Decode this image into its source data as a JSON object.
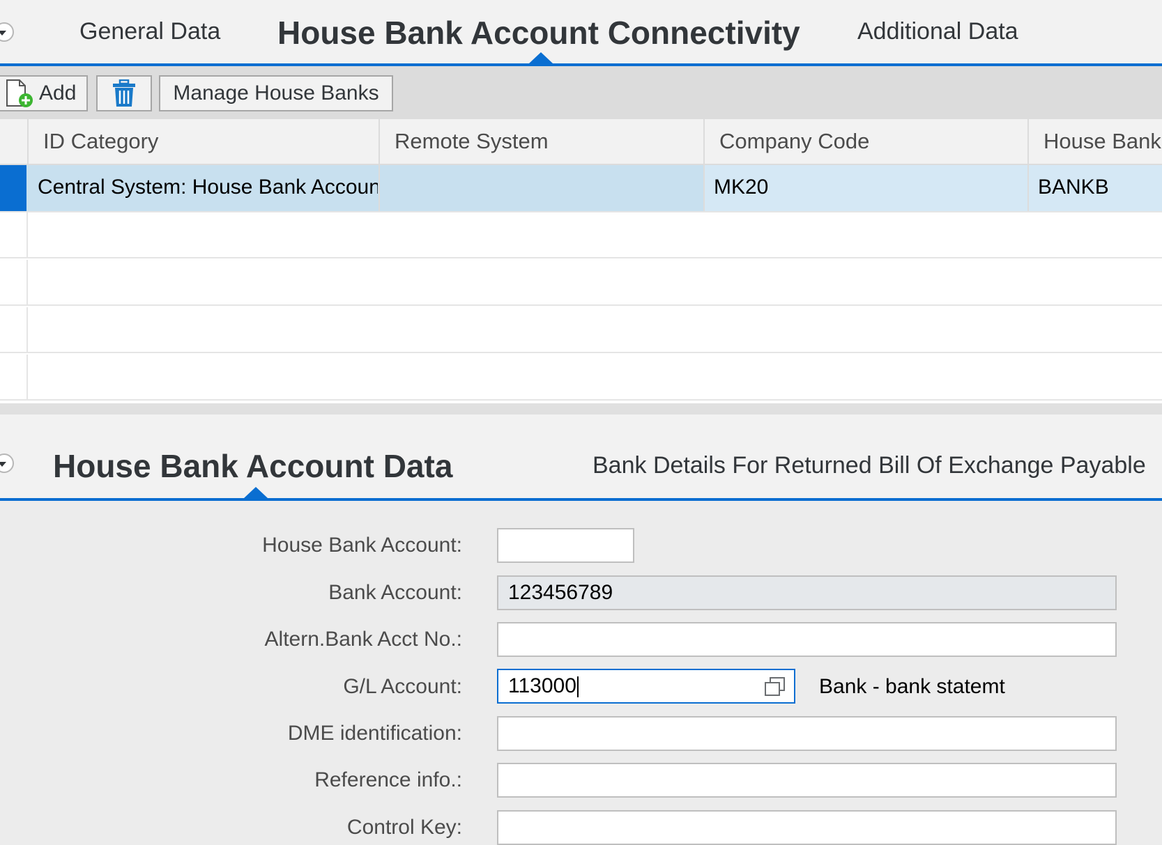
{
  "top_tabs": {
    "general": "General Data",
    "active": "House Bank Account Connectivity",
    "additional": "Additional Data"
  },
  "toolbar": {
    "add_label": "Add",
    "delete_icon": "trash-icon",
    "manage_label": "Manage House Banks"
  },
  "table": {
    "headers": [
      "ID Category",
      "Remote System",
      "Company Code",
      "House Bank"
    ],
    "rows": [
      {
        "id_category": "Central System: House Bank Account",
        "remote_system": "",
        "company_code": "MK20",
        "house_bank": "BANKB",
        "selected": true
      }
    ],
    "empty_rows": 4
  },
  "bottom_tabs": {
    "active": "House Bank Account Data",
    "other": "Bank Details For Returned Bill Of Exchange Payable"
  },
  "form": {
    "house_bank_account": {
      "label": "House Bank Account:",
      "value": ""
    },
    "bank_account": {
      "label": "Bank Account:",
      "value": "123456789"
    },
    "altern_bank_acct": {
      "label": "Altern.Bank Acct No.:",
      "value": ""
    },
    "gl_account": {
      "label": "G/L Account:",
      "value": "113000",
      "description": "Bank - bank statemt"
    },
    "dme_identification": {
      "label": "DME identification:",
      "value": ""
    },
    "reference_info": {
      "label": "Reference info.:",
      "value": ""
    },
    "control_key": {
      "label": "Control Key:",
      "value": ""
    }
  },
  "colors": {
    "accent": "#0a6ed1",
    "selected_row": "#c8e0ef",
    "selected_cell": "#d5e8f5"
  }
}
